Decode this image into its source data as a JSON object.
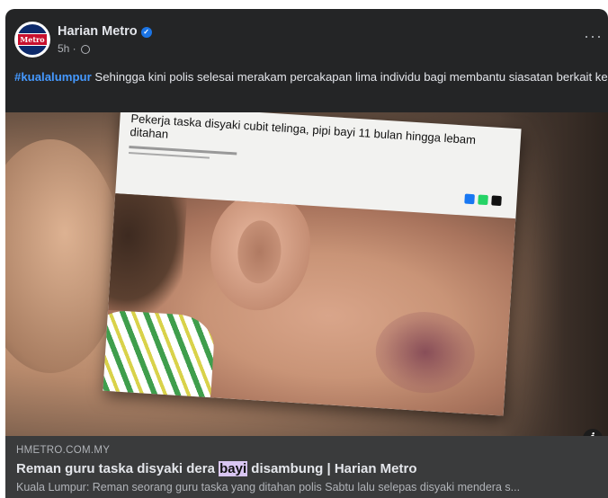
{
  "post": {
    "page_name": "Harian Metro",
    "avatar_text": "Metro",
    "time": "5h ·",
    "more_label": "···",
    "hashtag": "#kualalumpur",
    "text": " Sehingga kini polis selesai merakam percakapan lima individu bagi membantu siasatan berkait kes ini."
  },
  "image": {
    "clip_headline": "Pekerja taska disyaki cubit telinga, pipi bayi 11 bulan hingga lebam ditahan",
    "share_colors": [
      "#1877f2",
      "#25d366",
      "#111111"
    ],
    "info_label": "i"
  },
  "link": {
    "domain": "HMETRO.COM.MY",
    "title_before": "Reman guru taska disyaki dera ",
    "title_highlight": "bayi",
    "title_after": " disambung | Harian Metro",
    "description": "Kuala Lumpur: Reman seorang guru taska yang ditahan polis Sabtu lalu selepas disyaki mendera s..."
  }
}
